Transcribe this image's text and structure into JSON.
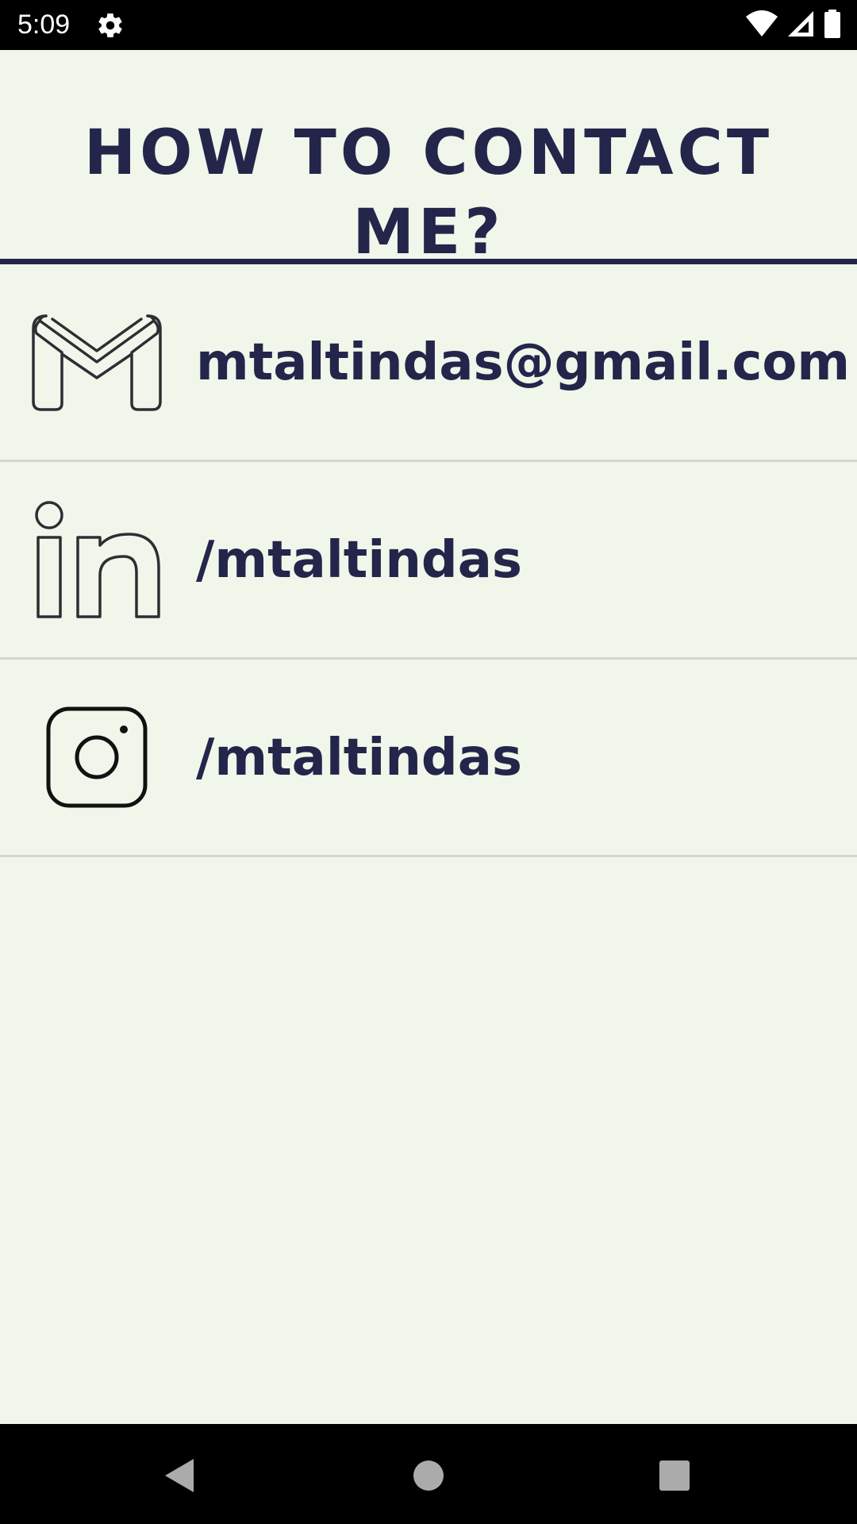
{
  "status_bar": {
    "time": "5:09",
    "icons": [
      "gear-icon",
      "wifi-icon",
      "cell-signal-icon",
      "battery-icon"
    ]
  },
  "header": {
    "title": "HOW TO CONTACT ME?"
  },
  "contacts": [
    {
      "icon": "gmail-icon",
      "value": "mtaltindas@gmail.com"
    },
    {
      "icon": "linkedin-icon",
      "value": "/mtaltindas"
    },
    {
      "icon": "instagram-icon",
      "value": "/mtaltindas"
    }
  ],
  "nav_bar": {
    "buttons": [
      "back-icon",
      "home-icon",
      "recents-icon"
    ]
  },
  "colors": {
    "background": "#f1f6ea",
    "accent": "#23264a",
    "divider": "#d3d8cd",
    "icon_stroke": "#2b2f33"
  }
}
